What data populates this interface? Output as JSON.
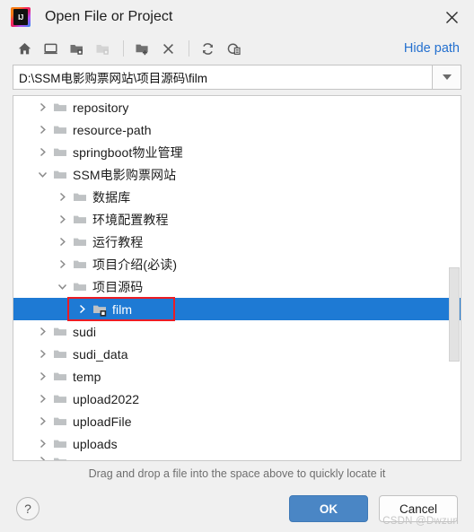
{
  "window": {
    "title": "Open File or Project",
    "app_icon": "intellij-idea-logo",
    "app_icon_text": "IJ",
    "close_icon": "close-icon"
  },
  "toolbar": {
    "items": [
      {
        "icon": "home-icon",
        "label": "Home",
        "disabled": false
      },
      {
        "icon": "desktop-icon",
        "label": "Desktop",
        "disabled": false
      },
      {
        "icon": "project-folder-icon",
        "label": "Project Directory",
        "disabled": false
      },
      {
        "icon": "module-folder-icon",
        "label": "Module Directory",
        "disabled": true
      },
      {
        "icon": "new-folder-icon",
        "label": "New Folder",
        "disabled": false
      },
      {
        "icon": "delete-icon",
        "label": "Delete",
        "disabled": false
      },
      {
        "icon": "refresh-icon",
        "label": "Refresh",
        "disabled": false
      },
      {
        "icon": "show-hidden-files-icon",
        "label": "Show Hidden Files and Directories",
        "disabled": false
      }
    ],
    "hide_path_label": "Hide path"
  },
  "path_field": {
    "value": "D:\\SSM电影购票网站\\项目源码\\film",
    "placeholder": "",
    "dropdown_icon": "chevron-down-icon"
  },
  "tree": {
    "rows": [
      {
        "label": "repository",
        "indent": 0,
        "expanded": false,
        "selected": false,
        "module": false
      },
      {
        "label": "resource-path",
        "indent": 0,
        "expanded": false,
        "selected": false,
        "module": false
      },
      {
        "label": "springboot物业管理",
        "indent": 0,
        "expanded": false,
        "selected": false,
        "module": false
      },
      {
        "label": "SSM电影购票网站",
        "indent": 0,
        "expanded": true,
        "selected": false,
        "module": false
      },
      {
        "label": "数据库",
        "indent": 1,
        "expanded": false,
        "selected": false,
        "module": false
      },
      {
        "label": "环境配置教程",
        "indent": 1,
        "expanded": false,
        "selected": false,
        "module": false
      },
      {
        "label": "运行教程",
        "indent": 1,
        "expanded": false,
        "selected": false,
        "module": false
      },
      {
        "label": "项目介绍(必读)",
        "indent": 1,
        "expanded": false,
        "selected": false,
        "module": false
      },
      {
        "label": "项目源码",
        "indent": 1,
        "expanded": true,
        "selected": false,
        "module": false
      },
      {
        "label": "film",
        "indent": 2,
        "expanded": false,
        "selected": true,
        "module": true
      },
      {
        "label": "sudi",
        "indent": 0,
        "expanded": false,
        "selected": false,
        "module": false
      },
      {
        "label": "sudi_data",
        "indent": 0,
        "expanded": false,
        "selected": false,
        "module": false
      },
      {
        "label": "temp",
        "indent": 0,
        "expanded": false,
        "selected": false,
        "module": false
      },
      {
        "label": "upload2022",
        "indent": 0,
        "expanded": false,
        "selected": false,
        "module": false
      },
      {
        "label": "uploadFile",
        "indent": 0,
        "expanded": false,
        "selected": false,
        "module": false
      },
      {
        "label": "uploads",
        "indent": 0,
        "expanded": false,
        "selected": false,
        "module": false
      }
    ],
    "scrollbar": {
      "thumb_top_pct": 47,
      "thumb_height_pct": 26
    }
  },
  "annotation": {
    "color": "#ec1c24",
    "target": "film"
  },
  "hint": "Drag and drop a file into the space above to quickly locate it",
  "buttons": {
    "help_label": "?",
    "ok_label": "OK",
    "cancel_label": "Cancel"
  },
  "watermark": "CSDN @Dwzun",
  "colors": {
    "selection": "#1e7ad4",
    "accent_link": "#2470cf",
    "ok_button": "#4a86c5",
    "annotation": "#ec1c24"
  }
}
